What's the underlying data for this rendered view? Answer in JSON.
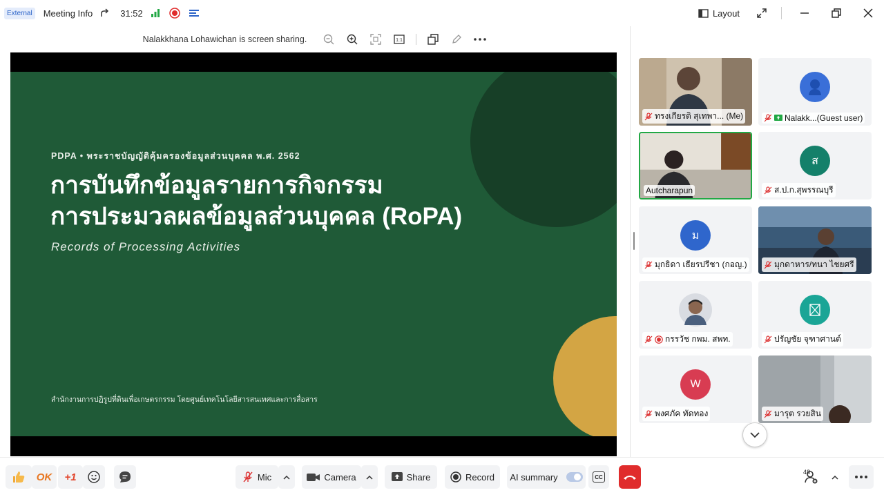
{
  "topbar": {
    "external_tag": "External",
    "meeting_info": "Meeting Info",
    "timer": "31:52",
    "layout_label": "Layout"
  },
  "share": {
    "banner": "Nalakkhana Lohawichan is screen sharing."
  },
  "slide": {
    "kicker": "PDPA  •  พระราชบัญญัติคุ้มครองข้อมูลส่วนบุคคล พ.ศ. 2562",
    "title_line1": "การบันทึกข้อมูลรายการกิจกรรม",
    "title_line2": "การประมวลผลข้อมูลส่วนบุคคล (RoPA)",
    "subtitle": "Records of Processing Activities",
    "footer": "สำนักงานการปฏิรูปที่ดินเพื่อเกษตรกรรม โดยศูนย์เทคโนโลยีสารสนเทศและการสื่อสาร",
    "colors": {
      "background": "#1f5a37",
      "dark_circle": "#173f27",
      "gold_circle": "#d3a544"
    }
  },
  "participants": [
    {
      "name": "ทรงเกียรติ สุเทพา...  (Me)",
      "type": "video",
      "muted": true
    },
    {
      "name": "Nalakk...(Guest user)",
      "type": "avatar",
      "avatar_color": "#3a6fd8",
      "avatar_letter": "",
      "muted": true,
      "sharing": true
    },
    {
      "name": "Autcharapun",
      "type": "video",
      "muted": false,
      "active_speaker": true
    },
    {
      "name": "ส.ป.ก.สุพรรณบุรี",
      "type": "avatar",
      "avatar_color": "#14806a",
      "avatar_letter": "ส",
      "muted": true
    },
    {
      "name": "มุกธิดา เธียรปรีชา (กอญ.)",
      "type": "avatar",
      "avatar_color": "#2f66cc",
      "avatar_letter": "ม",
      "muted": true
    },
    {
      "name": "มุกดาหาร/ทนา ไชยศรี",
      "type": "video",
      "muted": true
    },
    {
      "name": "กรรวัช กพม. สพท.",
      "type": "photo",
      "muted": true,
      "recording": true
    },
    {
      "name": "ปรัญชัย จุฑาศานต์",
      "type": "avatar",
      "avatar_color": "#1aa596",
      "avatar_letter": "",
      "muted": true
    },
    {
      "name": "พงศภัค ทัดทอง",
      "type": "avatar",
      "avatar_color": "#d83c52",
      "avatar_letter": "W",
      "muted": true
    },
    {
      "name": "มารุต รวยสิน",
      "type": "video",
      "muted": true
    }
  ],
  "toolbar": {
    "reaction_ok": "OK",
    "reaction_plus_one": "+1",
    "mic_label": "Mic",
    "camera_label": "Camera",
    "share_label": "Share",
    "record_label": "Record",
    "ai_summary_label": "AI summary",
    "cc_label": "CC",
    "participant_count": "48"
  }
}
